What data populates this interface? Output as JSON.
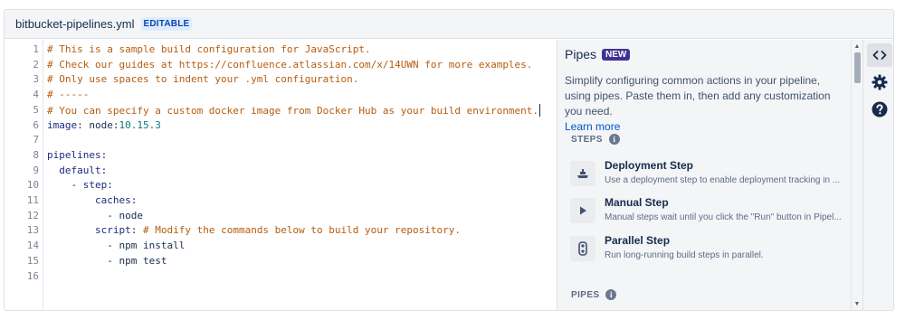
{
  "file": {
    "name": "bitbucket-pipelines.yml",
    "badge": "EDITABLE"
  },
  "editor": {
    "lines": [
      {
        "n": "1",
        "segs": [
          {
            "t": "# This is a sample build configuration for JavaScript.",
            "c": "comment"
          }
        ]
      },
      {
        "n": "2",
        "segs": [
          {
            "t": "# Check our guides at https://confluence.atlassian.com/x/14UWN for more examples.",
            "c": "comment"
          }
        ]
      },
      {
        "n": "3",
        "segs": [
          {
            "t": "# Only use spaces to indent your .yml configuration.",
            "c": "comment"
          }
        ]
      },
      {
        "n": "4",
        "segs": [
          {
            "t": "# -----",
            "c": "comment"
          }
        ]
      },
      {
        "n": "5",
        "segs": [
          {
            "t": "# You can specify a custom docker image from Docker Hub as your build environment.",
            "c": "comment"
          }
        ],
        "cursor": true
      },
      {
        "n": "6",
        "segs": [
          {
            "t": "image",
            "c": "key"
          },
          {
            "t": ": node:",
            "c": "plain"
          },
          {
            "t": "10.15.3",
            "c": "num"
          }
        ]
      },
      {
        "n": "7",
        "segs": []
      },
      {
        "n": "8",
        "segs": [
          {
            "t": "pipelines",
            "c": "key"
          },
          {
            "t": ":",
            "c": "plain"
          }
        ]
      },
      {
        "n": "9",
        "segs": [
          {
            "t": "  ",
            "c": "plain"
          },
          {
            "t": "default",
            "c": "key"
          },
          {
            "t": ":",
            "c": "plain"
          }
        ]
      },
      {
        "n": "10",
        "segs": [
          {
            "t": "    - ",
            "c": "plain"
          },
          {
            "t": "step",
            "c": "key"
          },
          {
            "t": ":",
            "c": "plain"
          }
        ]
      },
      {
        "n": "11",
        "segs": [
          {
            "t": "        ",
            "c": "plain"
          },
          {
            "t": "caches",
            "c": "key"
          },
          {
            "t": ":",
            "c": "plain"
          }
        ]
      },
      {
        "n": "12",
        "segs": [
          {
            "t": "          - node",
            "c": "plain"
          }
        ]
      },
      {
        "n": "13",
        "segs": [
          {
            "t": "        ",
            "c": "plain"
          },
          {
            "t": "script",
            "c": "key"
          },
          {
            "t": ": ",
            "c": "plain"
          },
          {
            "t": "# Modify the commands below to build your repository.",
            "c": "comment"
          }
        ]
      },
      {
        "n": "14",
        "segs": [
          {
            "t": "          - npm install",
            "c": "plain"
          }
        ]
      },
      {
        "n": "15",
        "segs": [
          {
            "t": "          - npm test",
            "c": "plain"
          }
        ]
      },
      {
        "n": "16",
        "segs": []
      }
    ]
  },
  "pipes": {
    "title": "Pipes",
    "new_badge": "NEW",
    "description": "Simplify configuring common actions in your pipeline, using pipes. Paste them in, then add any customization you need.",
    "learn_more": "Learn more",
    "steps_heading": "STEPS",
    "steps": [
      {
        "title": "Deployment Step",
        "desc": "Use a deployment step to enable deployment tracking in ...",
        "icon": "ship-icon"
      },
      {
        "title": "Manual Step",
        "desc": "Manual steps wait until you click the \"Run\" button in Pipel...",
        "icon": "play-icon"
      },
      {
        "title": "Parallel Step",
        "desc": "Run long-running build steps in parallel.",
        "icon": "parallel-icon"
      }
    ],
    "pipes_heading": "PIPES",
    "info_glyph": "i"
  },
  "rail": {
    "code_icon": "code-icon",
    "settings_icon": "gear-icon",
    "help_icon": "help-icon"
  }
}
